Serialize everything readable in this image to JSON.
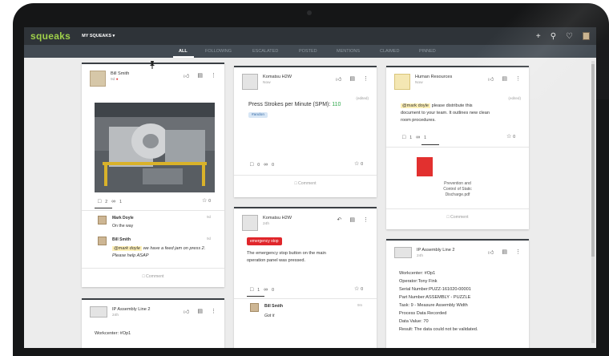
{
  "app": {
    "logo": "squeaks",
    "menu": "MY SQUEAKS ▾"
  },
  "tabs": [
    "ALL",
    "FOLLOWING",
    "ESCALATED",
    "POSTED",
    "MENTIONS",
    "CLAIMED",
    "PINNED"
  ],
  "colors": {
    "accent": "#9fd04a",
    "topbar": "#2e3338",
    "tabbar": "#424a52",
    "alert": "#e0262b"
  },
  "cards": {
    "bill": {
      "name": "Bill Smith",
      "time": "9d",
      "likes": "2",
      "attachments": "1",
      "stars": "0",
      "replies": [
        {
          "name": "Mark Doyle",
          "text": "On the way",
          "time": "9d"
        },
        {
          "name": "Bill Smith",
          "mention": "@mark doyle",
          "text": "we have a feed jam on press 2. Please help ASAP",
          "time": "9d"
        }
      ],
      "comment": "Comment"
    },
    "komatsu1": {
      "name": "Komatsu H2W",
      "time": "Now",
      "edited": "(edited)",
      "metric_label": "Press Strokes per Minute (SPM):",
      "metric_value": "110",
      "tag": "#andon",
      "likes": "0",
      "attachments": "0",
      "stars": "0",
      "comment": "Comment"
    },
    "hr": {
      "name": "Human Resources",
      "time": "Now",
      "edited": "(edited)",
      "mention": "@mark doyle",
      "text1": "please distribute this",
      "text2": "document to your team. It outlines new clean",
      "text3": "room procedures.",
      "likes": "1",
      "attachments": "1",
      "stars": "0",
      "file1": "Prevention and",
      "file2": "Control of Static",
      "file3": "Discharge.pdf",
      "comment": "Comment"
    },
    "komatsu2": {
      "name": "Komatsu H2W",
      "time": "24h",
      "badge": "emergency stop",
      "text1": "The emergency stop button on the main",
      "text2": "operation panel was pressed.",
      "likes": "1",
      "attachments": "0",
      "stars": "0",
      "reply_name": "Bill Smith",
      "reply_text": "Got it",
      "reply_time": "9m"
    },
    "ip_left": {
      "name": "IP Assembly Line 2",
      "time": "24h",
      "field": "Workcenter: #Op1"
    },
    "ip_right": {
      "name": "IP Assembly Line 2",
      "time": "24h",
      "lines": [
        "Workcenter: #Op1",
        "Operator:Tony Fink",
        "Serial Number:PUZZ-161020-00001",
        "Part Number:ASSEMBLY - PUZZLE",
        "Task: 9 - Measure Assembly Width",
        "Process Data Recorded",
        "Data Value: 70",
        "Result: The data could not be validated."
      ]
    }
  },
  "icons": [
    "plus-icon",
    "search-icon",
    "bell-icon",
    "user-icon",
    "thumbs-up-icon",
    "inbox-icon",
    "more-icon",
    "comment-icon",
    "paperclip-icon",
    "star-icon",
    "pin-icon",
    "pdf-icon"
  ]
}
